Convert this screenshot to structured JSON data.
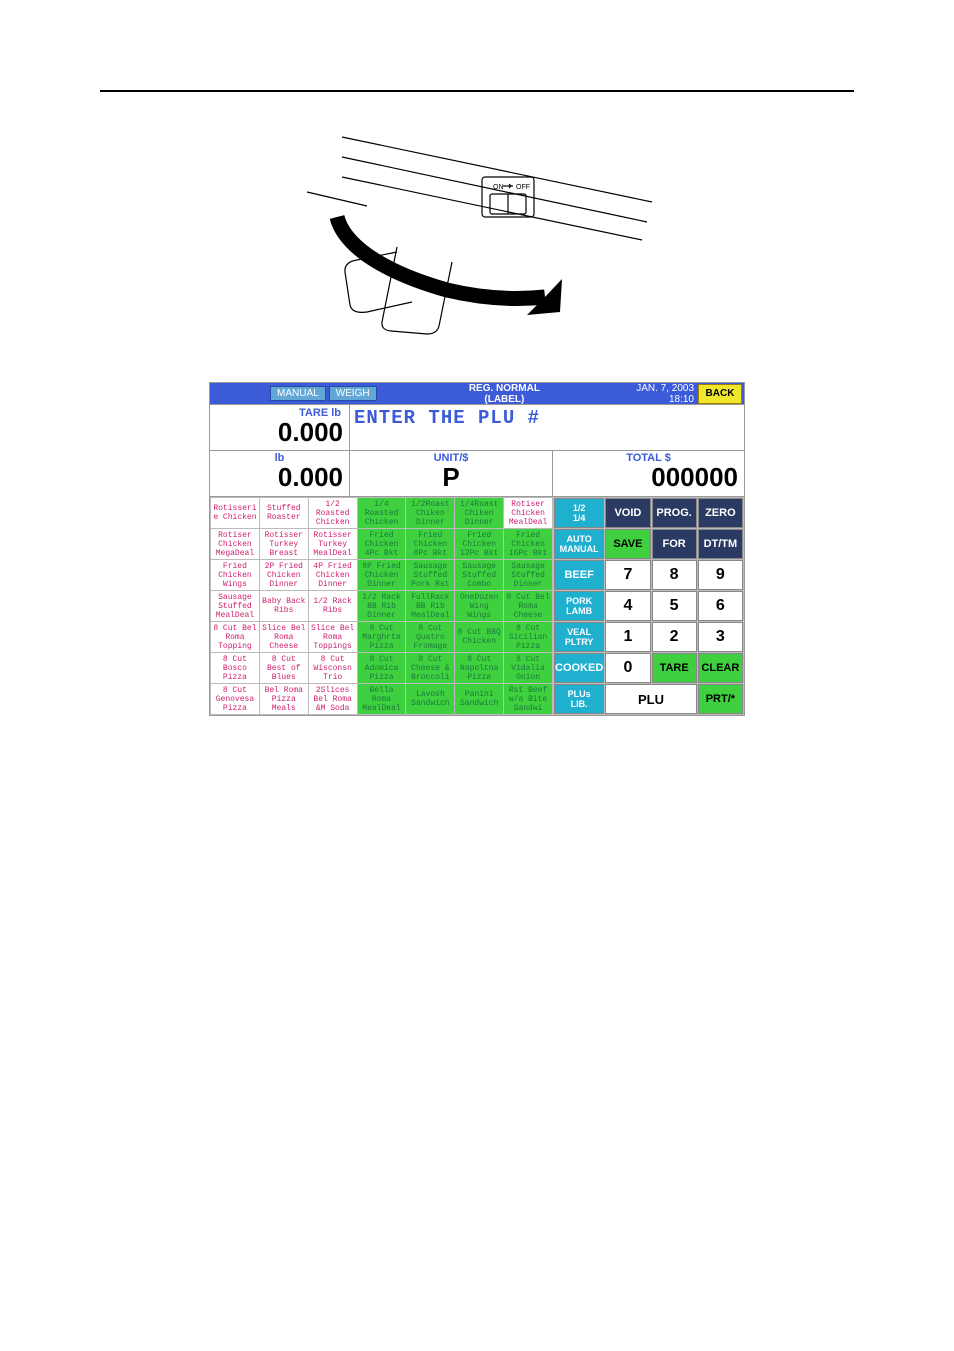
{
  "topbar": {
    "manual": "MANUAL",
    "weigh": "WEIGH",
    "title_line1": "REG. NORMAL",
    "title_line2": "(LABEL)",
    "date_line1": "JAN.   7, 2003",
    "date_line2": "18:10",
    "back": "BACK"
  },
  "tare": {
    "label": "TARE  lb",
    "value": "0.000"
  },
  "plu_prompt": "ENTER THE PLU #",
  "row3": {
    "lb_label": "lb",
    "lb_value": "0.000",
    "unit_label": "UNIT/$",
    "unit_value": "P",
    "total_label": "TOTAL $",
    "total_value": "000000"
  },
  "plu_cells": [
    [
      {
        "t": "Rotisseri e Chicken"
      },
      {
        "t": "Stuffed Roaster"
      },
      {
        "t": "1/2 Roasted Chicken"
      },
      {
        "t": "1/4 Roasted Chicken",
        "c": "green"
      },
      {
        "t": "1/2Roast Chiken Dinner",
        "c": "green"
      },
      {
        "t": "1/4Roast Chiken Dinner",
        "c": "green"
      },
      {
        "t": "Rotiser Chicken MealDeal"
      }
    ],
    [
      {
        "t": "Rotiser Chicken MegaDeal"
      },
      {
        "t": "Rotisser Turkey Breast"
      },
      {
        "t": "Rotisser Turkey MealDeal"
      },
      {
        "t": "Fried Chicken 4Pc Bkt",
        "c": "green"
      },
      {
        "t": "Fried Chicken 8Pc Bkt",
        "c": "green"
      },
      {
        "t": "Fried Chicken 12Pc Bkt",
        "c": "green"
      },
      {
        "t": "Fried Chicken 16Pc Bkt",
        "c": "green"
      }
    ],
    [
      {
        "t": "Fried Chicken Wings"
      },
      {
        "t": "2P Fried Chicken Dinner"
      },
      {
        "t": "4P Fried Chicken Dinner"
      },
      {
        "t": "8P Fried Chicken Dinner",
        "c": "green"
      },
      {
        "t": "Sausage Stuffed Pork Rst",
        "c": "green"
      },
      {
        "t": "Sausage Stuffed Combo",
        "c": "green"
      },
      {
        "t": "Sausage Stuffed Dinner",
        "c": "green"
      }
    ],
    [
      {
        "t": "Sausage Stuffed MealDeal"
      },
      {
        "t": "Baby Back Ribs"
      },
      {
        "t": "1/2 Rack Ribs"
      },
      {
        "t": "1/2 Rack BB Rib Dinner",
        "c": "green"
      },
      {
        "t": "FullRack BB Rib MealDeal",
        "c": "green"
      },
      {
        "t": "OneDozen Wing Wings",
        "c": "green"
      },
      {
        "t": "8 Cut Bel Roma Cheese",
        "c": "green"
      }
    ],
    [
      {
        "t": "8 Cut Bel Roma Topping"
      },
      {
        "t": "Slice Bel Roma Cheese"
      },
      {
        "t": "Slice Bel Roma Toppings"
      },
      {
        "t": "8 Cut Marghrta Pizza",
        "c": "green"
      },
      {
        "t": "8 Cut Quatro Fromage",
        "c": "green"
      },
      {
        "t": "8 Cut BBQ Chicken",
        "c": "green"
      },
      {
        "t": "8 Cut Sicilian Pizza",
        "c": "green"
      }
    ],
    [
      {
        "t": "8 Cut Bosco Pizza"
      },
      {
        "t": "8 Cut Best of Blues"
      },
      {
        "t": "8 Cut Wisconsn Trio"
      },
      {
        "t": "8 Cut Adomica Pizza",
        "c": "green"
      },
      {
        "t": "8 Cut Cheese & Broccoli",
        "c": "green"
      },
      {
        "t": "8 Cut Napoltna Pizza",
        "c": "green"
      },
      {
        "t": "8 Cut Vidalia Onion",
        "c": "green"
      }
    ],
    [
      {
        "t": "8 Cut Genovesa Pizza"
      },
      {
        "t": "Bel Roma Pizza Meals"
      },
      {
        "t": "2Slices Bel Roma &M Soda"
      },
      {
        "t": "Bella Roma MealDeal",
        "c": "green"
      },
      {
        "t": "Lavosh Sandwich",
        "c": "green"
      },
      {
        "t": "Panini Sandwich",
        "c": "green"
      },
      {
        "t": "Rst Beef w/a Bite Sandwi",
        "c": "green"
      }
    ]
  ],
  "keypad": {
    "half_qtr_1": "1/2",
    "half_qtr_2": "1/4",
    "void": "VOID",
    "prog": "PROG.",
    "zero": "ZERO",
    "auto_1": "AUTO",
    "auto_2": "MANUAL",
    "save": "SAVE",
    "for": "FOR",
    "dttm": "DT/TM",
    "beef": "BEEF",
    "k7": "7",
    "k8": "8",
    "k9": "9",
    "pork_1": "PORK",
    "pork_2": "LAMB",
    "k4": "4",
    "k5": "5",
    "k6": "6",
    "veal_1": "VEAL",
    "veal_2": "PLTRY",
    "k1": "1",
    "k2": "2",
    "k3": "3",
    "cooked": "COOKED",
    "k0": "0",
    "tare": "TARE",
    "clear": "CLEAR",
    "plus_1": "PLUs",
    "plus_2": "LIB.",
    "plu": "PLU",
    "prt": "PRT/*"
  }
}
